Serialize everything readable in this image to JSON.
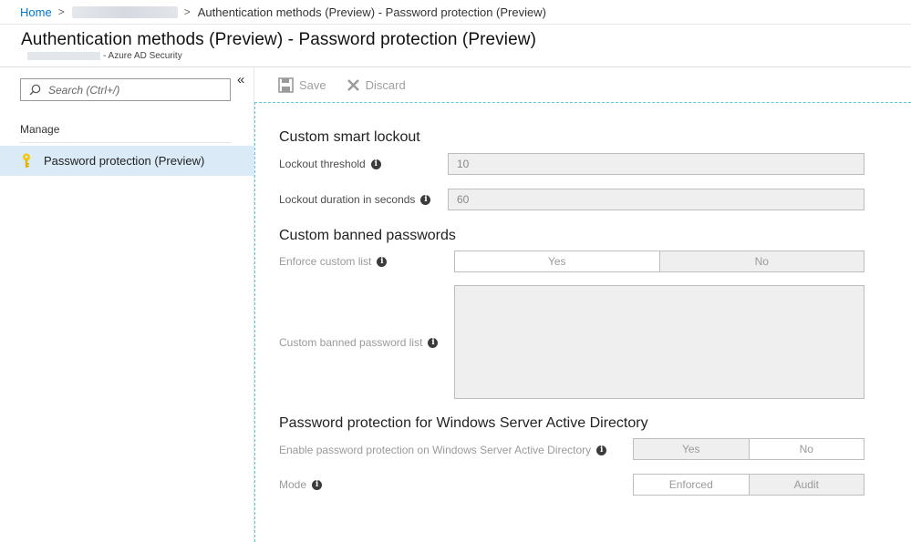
{
  "breadcrumb": {
    "home": "Home",
    "separator": ">",
    "current": "Authentication methods (Preview) - Password protection (Preview)"
  },
  "header": {
    "title": "Authentication methods (Preview) - Password protection (Preview)",
    "subtitle": "- Azure AD Security"
  },
  "nav": {
    "search_placeholder": "Search (Ctrl+/)",
    "collapse_glyph": "«",
    "section_title": "Manage",
    "items": [
      {
        "label": "Password protection (Preview)",
        "icon": "key-icon",
        "selected": true
      }
    ]
  },
  "toolbar": {
    "save_label": "Save",
    "discard_label": "Discard"
  },
  "content": {
    "smart_lockout": {
      "title": "Custom smart lockout",
      "threshold_label": "Lockout threshold",
      "threshold_value": "10",
      "duration_label": "Lockout duration in seconds",
      "duration_value": "60"
    },
    "banned_passwords": {
      "title": "Custom banned passwords",
      "enforce_label": "Enforce custom list",
      "enforce_yes": "Yes",
      "enforce_no": "No",
      "enforce_selected": "No",
      "list_label": "Custom banned password list",
      "list_value": ""
    },
    "windows_ad": {
      "title": "Password protection for Windows Server Active Directory",
      "enable_label": "Enable password protection on Windows Server Active Directory",
      "enable_yes": "Yes",
      "enable_no": "No",
      "enable_selected": "Yes",
      "mode_label": "Mode",
      "mode_enforced": "Enforced",
      "mode_audit": "Audit",
      "mode_selected": "Audit"
    }
  },
  "colors": {
    "link": "#0078d4",
    "nav_selected_bg": "#daeaf7",
    "key_icon": "#f2c811",
    "focus_outline": "#5ec8d6"
  }
}
